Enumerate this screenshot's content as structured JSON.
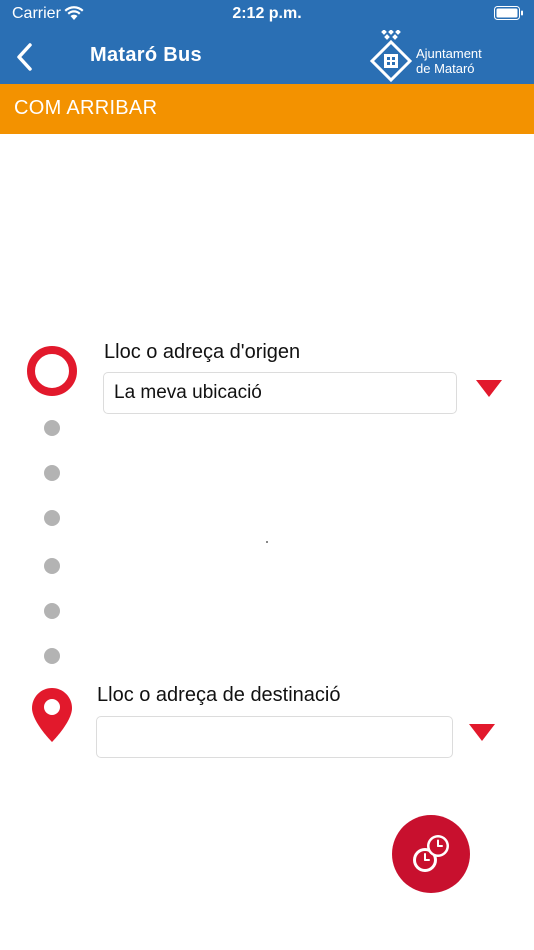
{
  "status_bar": {
    "carrier": "Carrier",
    "time": "2:12 p.m."
  },
  "nav": {
    "back_icon": "chevron-left-icon",
    "title": "Mataró Bus",
    "logo_line1": "Ajuntament",
    "logo_line2": "de Mataró"
  },
  "section": {
    "title": "COM ARRIBAR"
  },
  "origin": {
    "label": "Lloc o adreça d'origen",
    "value": "La meva ubicació",
    "icon": "origin-circle-icon"
  },
  "destination": {
    "label": "Lloc o adreça de destinació",
    "value": "",
    "icon": "map-pin-icon"
  },
  "fab": {
    "icon": "clock-icon"
  },
  "colors": {
    "nav_bg": "#2a6fb4",
    "section_bg": "#f39200",
    "accent_red": "#e2192c",
    "fab_bg": "#c8102e",
    "dot_gray": "#b3b3b3"
  }
}
